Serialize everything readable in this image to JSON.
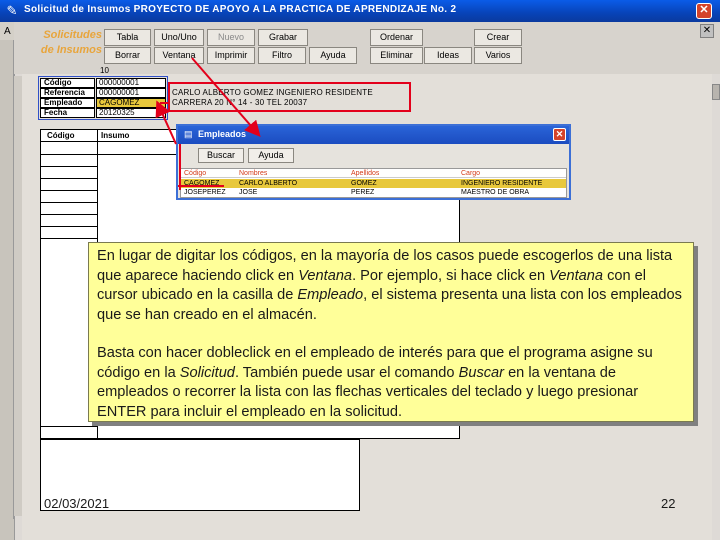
{
  "window": {
    "title": "Solicitud de Insumos   PROYECTO DE APOYO A LA PRACTICA DE APRENDIZAJE No. 2",
    "close_glyph": "✕",
    "inner_close_glyph": "✕",
    "side_letter": "A"
  },
  "section": {
    "title_line1": "Solicitudes",
    "title_line2": "de Insumos"
  },
  "toolbar": {
    "row1": [
      "Tabla",
      "Uno/Uno",
      "Nuevo",
      "Grabar",
      "Ordenar",
      "Crear"
    ],
    "row2": [
      "Borrar",
      "Ventana",
      "Imprimir",
      "Filtro",
      "Ayuda",
      "Eliminar",
      "Ideas",
      "Varios"
    ],
    "disabled": [
      "Nuevo"
    ]
  },
  "form": {
    "top_number": "10",
    "labels": [
      "Código",
      "Referencia",
      "Empleado",
      "Fecha"
    ],
    "values": [
      "000000001",
      "000000001",
      "CAGOMEZ",
      "20120325"
    ],
    "reference_text_1": "CARLO ALBERTO GOMEZ  INGENIERO RESIDENTE",
    "reference_text_2": "CARRERA 20 N° 14 - 30 TEL 20037"
  },
  "grid": {
    "headers": [
      "Código",
      "Insumo"
    ]
  },
  "dialog": {
    "title": "Empleados",
    "buttons": [
      "Buscar",
      "Ayuda"
    ],
    "columns": [
      "Código",
      "Nombres",
      "Apellidos",
      "Cargo"
    ],
    "rows": [
      [
        "CAGOMEZ",
        "CARLO ALBERTO",
        "GOMEZ",
        "INGENIERO RESIDENTE"
      ],
      [
        "JOSEPEREZ",
        "JOSE",
        "PEREZ",
        "MAESTRO DE OBRA"
      ]
    ],
    "selected_row": 0,
    "close_glyph": "✕"
  },
  "callout": {
    "p1_a": "En lugar de digitar los códigos, en la mayoría de los casos puede escogerlos de una lista que aparece haciendo click en ",
    "p1_b": "Ventana",
    "p1_c": ". Por ejemplo, si hace click en ",
    "p1_d": "Ventana",
    "p1_e": " con el cursor ubicado en la casilla de ",
    "p1_f": "Empleado",
    "p1_g": ", el sistema presenta una lista con los empleados que se han creado en el almacén.",
    "p2_a": "Basta con hacer dobleclick en el empleado de interés para que el programa asigne su código en la ",
    "p2_b": "Solicitud",
    "p2_c": ". También puede usar el comando ",
    "p2_d": "Buscar",
    "p2_e": " en la ventana de empleados o recorrer la lista con las flechas verticales del teclado y luego presionar ENTER para incluir el empleado en la solicitud."
  },
  "footer": {
    "date": "02/03/2021",
    "page": "22"
  },
  "colors": {
    "title_bar": "#0843b8",
    "section_title": "#e8a53c",
    "highlight": "#e8c83c",
    "annotation_red": "#e3001b",
    "callout_bg": "#ffff99"
  }
}
